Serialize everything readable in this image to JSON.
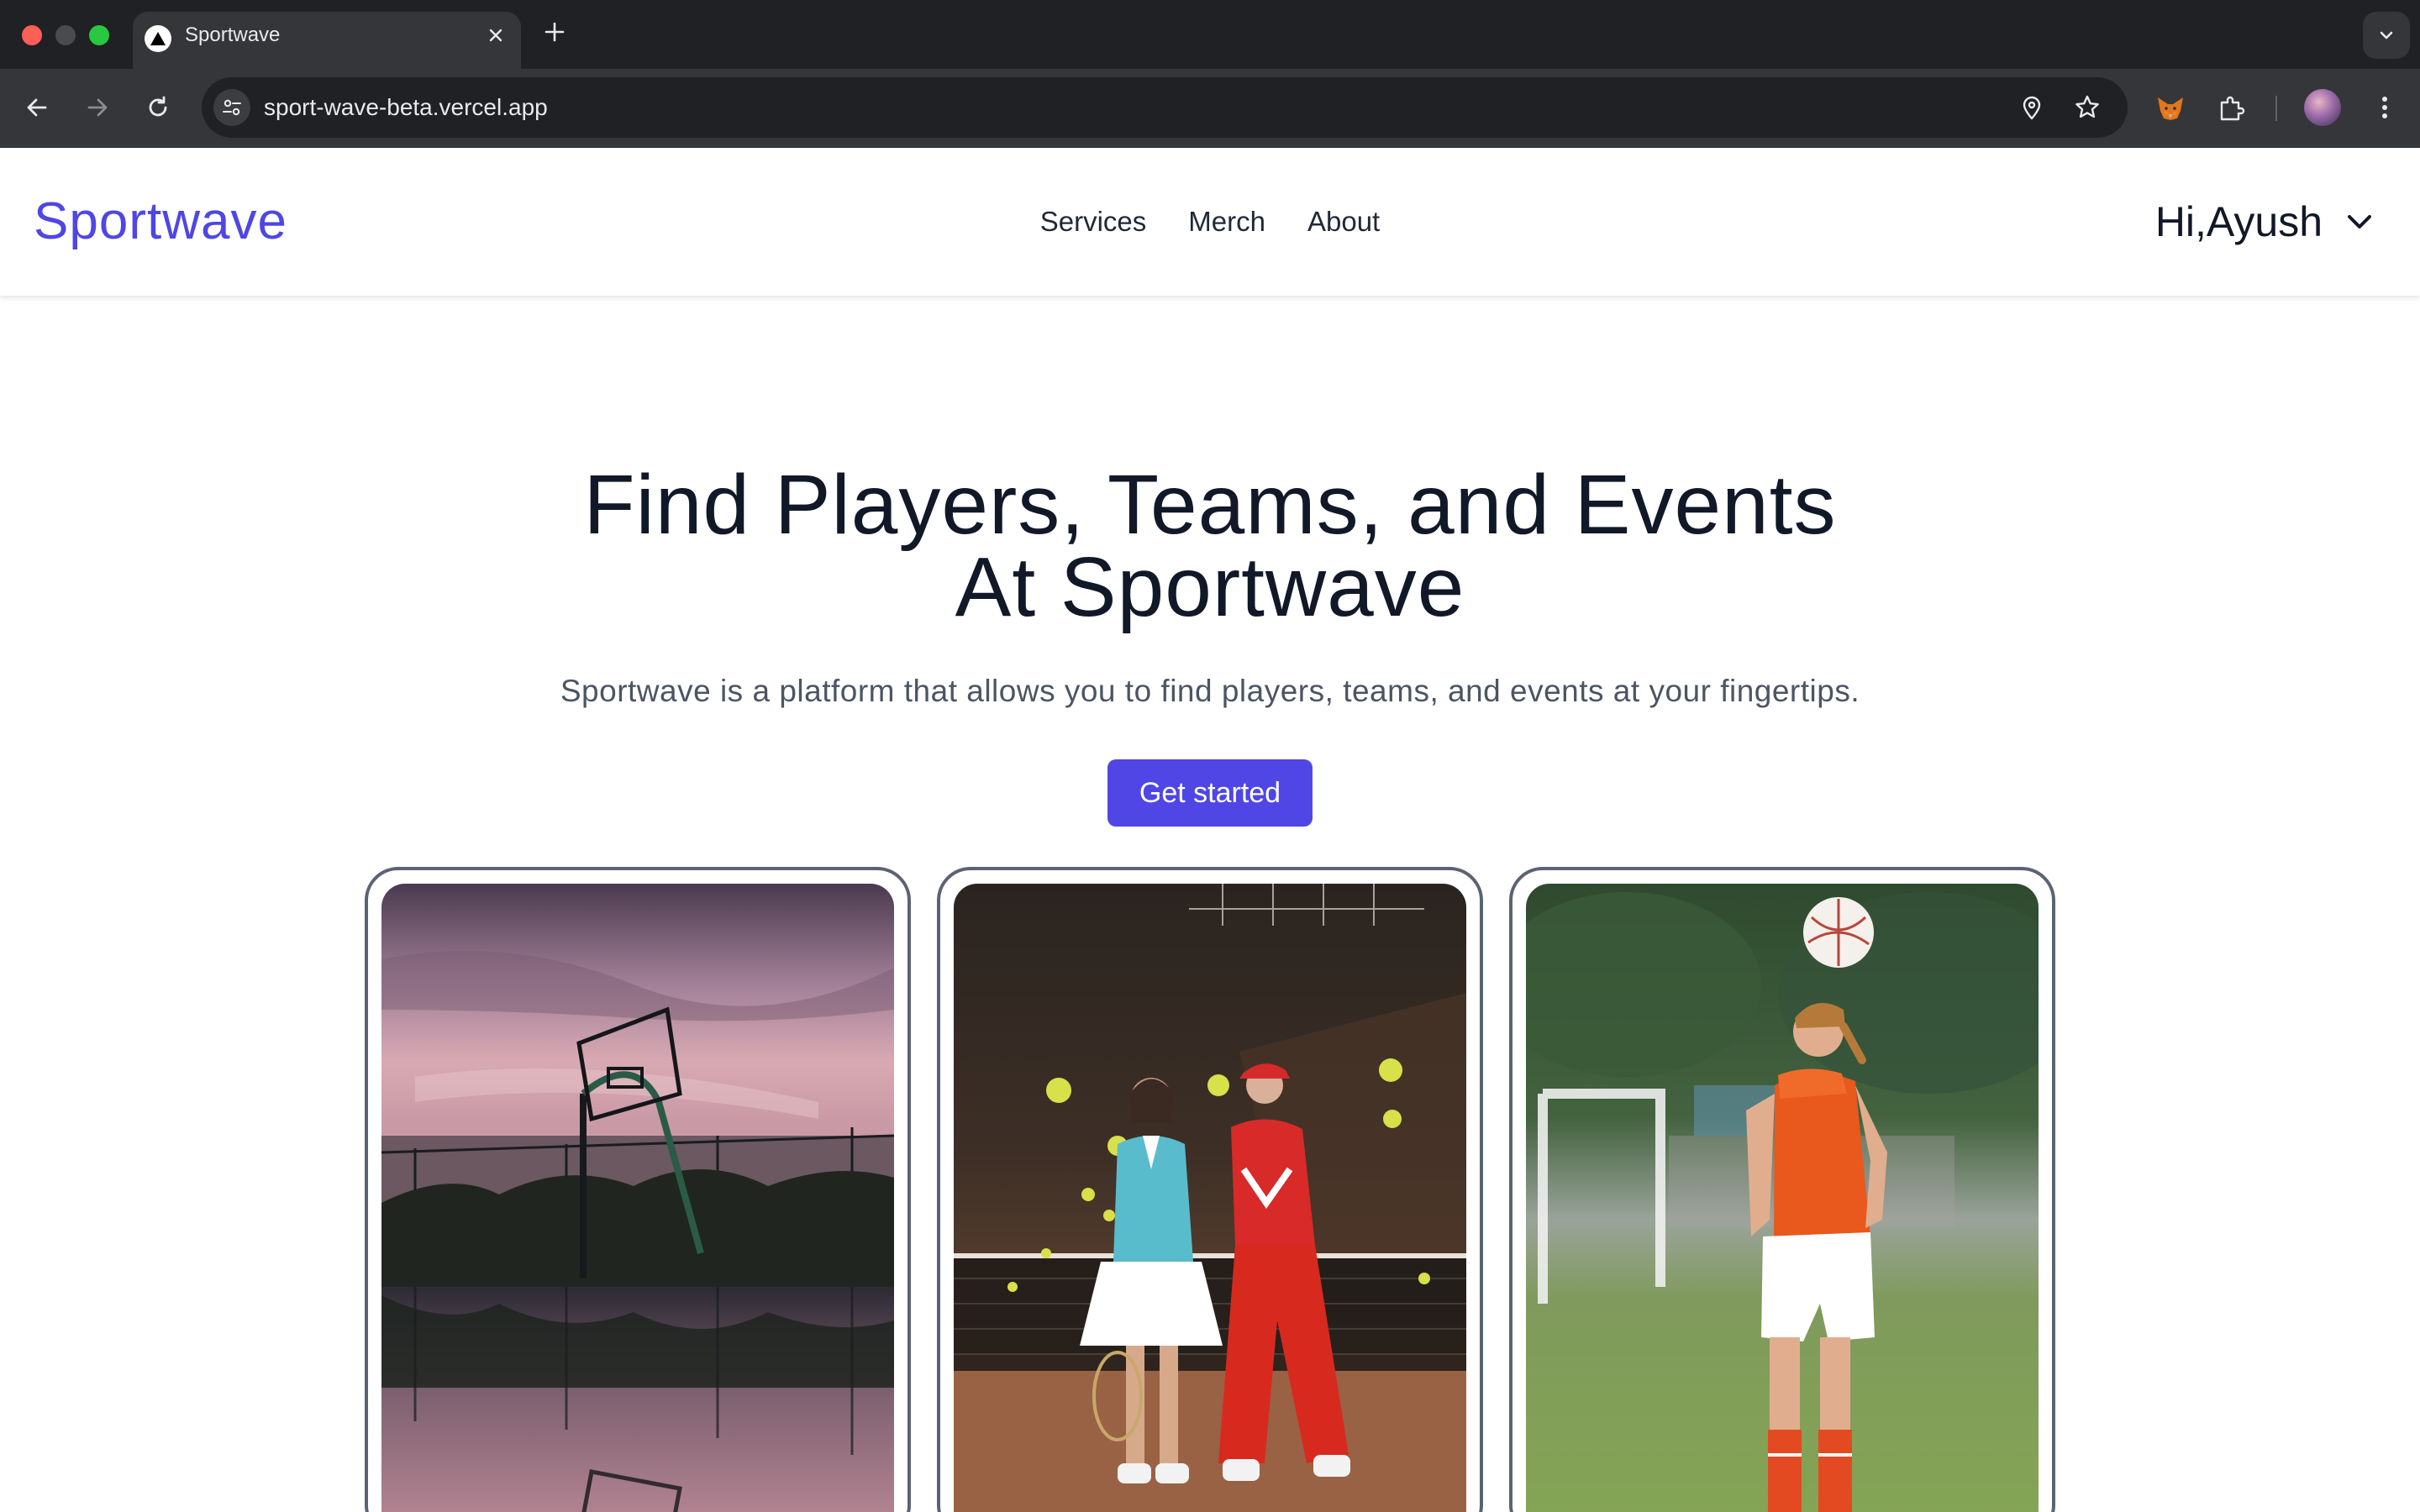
{
  "browser": {
    "tab_title": "Sportwave",
    "url": "sport-wave-beta.vercel.app"
  },
  "header": {
    "logo": "Sportwave",
    "nav": [
      {
        "label": "Services"
      },
      {
        "label": "Merch"
      },
      {
        "label": "About"
      }
    ],
    "greeting": "Hi,Ayush"
  },
  "hero": {
    "title_line1": "Find Players, Teams, and Events",
    "title_line2": "At Sportwave",
    "subtitle": "Sportwave is a platform that allows you to find players, teams, and events at your fingertips.",
    "cta_label": "Get started"
  },
  "cards": [
    {
      "image": "basketball-court-sunset-photo"
    },
    {
      "image": "tennis-players-photo"
    },
    {
      "image": "soccer-girl-header-photo"
    }
  ],
  "colors": {
    "brand": "#4f46e5",
    "heading": "#111827",
    "body_text": "#4b5563",
    "card_border": "#5b6274"
  }
}
